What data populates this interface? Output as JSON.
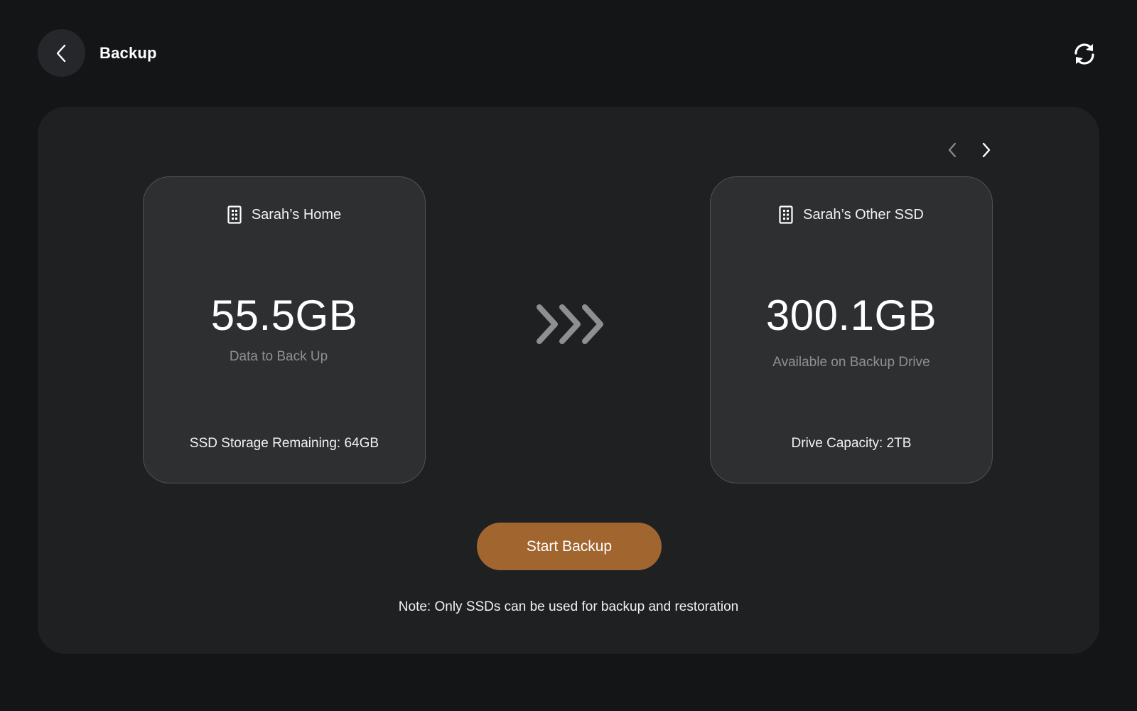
{
  "header": {
    "title": "Backup",
    "back_icon": "chevron-left-icon",
    "refresh_icon": "refresh-icon"
  },
  "pager": {
    "prev_icon": "chevron-left-icon",
    "next_icon": "chevron-right-icon"
  },
  "source_drive": {
    "icon": "drive-icon",
    "name": "Sarah’s Home",
    "value": "55.5GB",
    "value_label": "Data to Back Up",
    "footer": "SSD Storage Remaining: 64GB"
  },
  "target_drive": {
    "icon": "drive-icon",
    "name": "Sarah’s Other SSD",
    "value": "300.1GB",
    "value_label": "Available on Backup Drive",
    "footer": "Drive Capacity: 2TB"
  },
  "transfer_icon": "triple-chevron-right-icon",
  "actions": {
    "start_label": "Start Backup"
  },
  "note": "Note: Only SSDs can be used for backup and restoration",
  "colors": {
    "background": "#141517",
    "panel": "#1f2022",
    "card": "#2e2f31",
    "accent": "#a1652f",
    "muted_text": "#8f9094"
  }
}
